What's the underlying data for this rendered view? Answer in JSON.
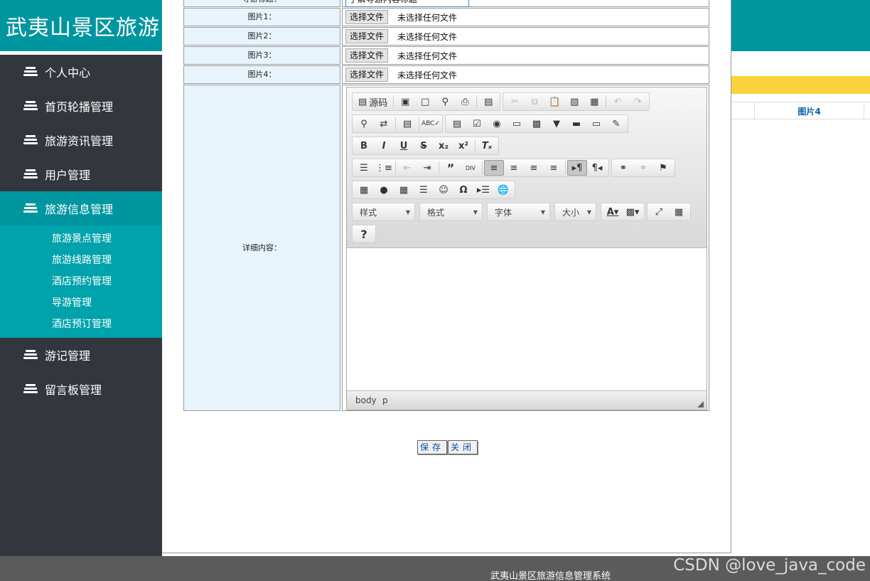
{
  "header": {
    "title": "武夷山景区旅游"
  },
  "sidebar": {
    "items": [
      {
        "label": "个人中心"
      },
      {
        "label": "首页轮播管理"
      },
      {
        "label": "旅游资讯管理"
      },
      {
        "label": "用户管理"
      },
      {
        "label": "旅游信息管理",
        "active": true,
        "children": [
          {
            "label": "旅游景点管理"
          },
          {
            "label": "旅游线路管理"
          },
          {
            "label": "酒店预约管理"
          },
          {
            "label": "导游管理"
          },
          {
            "label": "酒店预订管理"
          }
        ]
      },
      {
        "label": "游记管理"
      },
      {
        "label": "留言板管理"
      }
    ]
  },
  "background": {
    "column_label": "图片4"
  },
  "form": {
    "top_row": {
      "label": "导游标题：",
      "value": "了解导游内容标题"
    },
    "image_rows": [
      {
        "label": "图片1：",
        "button": "选择文件",
        "status": "未选择任何文件"
      },
      {
        "label": "图片2：",
        "button": "选择文件",
        "status": "未选择任何文件"
      },
      {
        "label": "图片3：",
        "button": "选择文件",
        "status": "未选择任何文件"
      },
      {
        "label": "图片4：",
        "button": "选择文件",
        "status": "未选择任何文件"
      }
    ],
    "detail_label": "详细内容：",
    "editor": {
      "source_label": "源码",
      "combos": {
        "styles": "样式",
        "format": "格式",
        "font": "字体",
        "size": "大小"
      },
      "help": "?",
      "path": {
        "body": "body",
        "p": "p"
      }
    },
    "save_label": "保存",
    "close_label": "关闭"
  },
  "footer": {
    "text": "武夷山景区旅游信息管理系统",
    "watermark": "CSDN @love_java_code"
  }
}
